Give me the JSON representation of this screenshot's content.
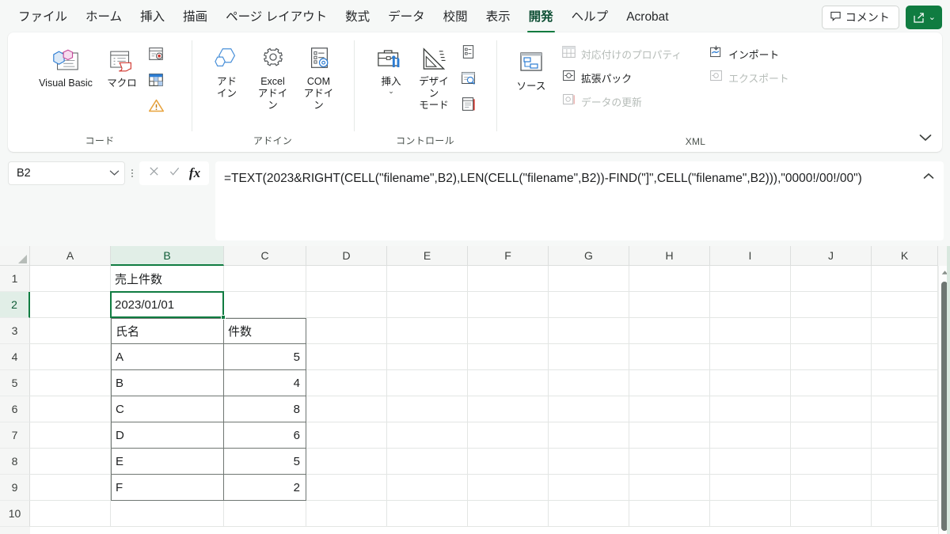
{
  "tabs": [
    {
      "label": "ファイル",
      "active": false
    },
    {
      "label": "ホーム",
      "active": false
    },
    {
      "label": "挿入",
      "active": false
    },
    {
      "label": "描画",
      "active": false
    },
    {
      "label": "ページ レイアウト",
      "active": false
    },
    {
      "label": "数式",
      "active": false
    },
    {
      "label": "データ",
      "active": false
    },
    {
      "label": "校閲",
      "active": false
    },
    {
      "label": "表示",
      "active": false
    },
    {
      "label": "開発",
      "active": true
    },
    {
      "label": "ヘルプ",
      "active": false
    },
    {
      "label": "Acrobat",
      "active": false
    }
  ],
  "titlebar": {
    "comment_label": "コメント",
    "comment_icon": "comment-icon",
    "share_icon": "share-icon",
    "share_caret": "⌄",
    "accent_color": "#107c41"
  },
  "ribbon": {
    "collapse_icon": "chevron-down-icon",
    "groups": [
      {
        "name": "code",
        "title": "コード",
        "big": [
          {
            "label": "Visual Basic",
            "icon": "visual-basic-icon",
            "width": "wide"
          },
          {
            "label": "マクロ",
            "icon": "macro-icon",
            "width": "narrow"
          }
        ],
        "small": [
          {
            "label": "マクロの記録",
            "icon": "record-macro-icon"
          },
          {
            "label": "相対参照で記録",
            "icon": "relative-reference-icon"
          },
          {
            "label": "マクロのセキュリティ",
            "icon": "macro-security-icon"
          }
        ]
      },
      {
        "name": "addins",
        "title": "アドイン",
        "big": [
          {
            "label": "アド\nイン",
            "icon": "addins-icon",
            "width": "narrow"
          },
          {
            "label": "Excel\nアドイン",
            "icon": "excel-addins-icon",
            "width": "narrow"
          },
          {
            "label": "COM\nアドイン",
            "icon": "com-addins-icon",
            "width": "narrow"
          }
        ],
        "small": []
      },
      {
        "name": "controls",
        "title": "コントロール",
        "big": [
          {
            "label": "挿入",
            "icon": "insert-control-icon",
            "width": "narrow",
            "caret": "⌄"
          },
          {
            "label": "デザイン\nモード",
            "icon": "design-mode-icon",
            "width": "narrow"
          }
        ],
        "small": [
          {
            "label": "プロパティ",
            "icon": "properties-icon"
          },
          {
            "label": "コードの表示",
            "icon": "view-code-icon"
          },
          {
            "label": "ダイアログの実行",
            "icon": "run-dialog-icon"
          }
        ]
      },
      {
        "name": "xml",
        "title": "XML",
        "big": [
          {
            "label": "ソース",
            "icon": "xml-source-icon",
            "width": "narrow"
          }
        ],
        "rows_left": [
          {
            "label": "対応付けのプロパティ",
            "icon": "map-properties-icon",
            "disabled": true
          },
          {
            "label": "拡張パック",
            "icon": "expansion-packs-icon",
            "disabled": false
          },
          {
            "label": "データの更新",
            "icon": "refresh-data-icon",
            "disabled": true
          }
        ],
        "rows_right": [
          {
            "label": "インポート",
            "icon": "import-icon",
            "disabled": false
          },
          {
            "label": "エクスポート",
            "icon": "export-icon",
            "disabled": true
          }
        ]
      }
    ]
  },
  "formula_bar": {
    "namebox_value": "B2",
    "namebox_caret": "⌄",
    "more_icon": "more-vertical-icon",
    "cancel_icon": "cancel-icon",
    "enter_icon": "enter-icon",
    "fx_icon": "insert-function-icon",
    "fx_label": "fx",
    "formula": "=TEXT(2023&RIGHT(CELL(\"filename\",B2),LEN(CELL(\"filename\",B2))-FIND(\"]\",CELL(\"filename\",B2))),\"0000!/00!/00\")",
    "expand_icon": "chevron-up-icon"
  },
  "grid": {
    "columns": [
      {
        "label": "A",
        "width": 102,
        "selected": false
      },
      {
        "label": "B",
        "width": 143,
        "selected": true
      },
      {
        "label": "C",
        "width": 104,
        "selected": false
      },
      {
        "label": "D",
        "width": 102,
        "selected": false
      },
      {
        "label": "E",
        "width": 102,
        "selected": false
      },
      {
        "label": "F",
        "width": 102,
        "selected": false
      },
      {
        "label": "G",
        "width": 102,
        "selected": false
      },
      {
        "label": "H",
        "width": 102,
        "selected": false
      },
      {
        "label": "I",
        "width": 102,
        "selected": false
      },
      {
        "label": "J",
        "width": 102,
        "selected": false
      },
      {
        "label": "K",
        "width": 84,
        "selected": false
      }
    ],
    "rows": [
      {
        "header": "1",
        "selected": false,
        "cells": {
          "B": "売上件数"
        }
      },
      {
        "header": "2",
        "selected": true,
        "cells": {
          "B": "2023/01/01"
        }
      },
      {
        "header": "3",
        "selected": false,
        "cells": {
          "B": "氏名",
          "C": "件数"
        }
      },
      {
        "header": "4",
        "selected": false,
        "cells": {
          "B": "A",
          "C": "5"
        }
      },
      {
        "header": "5",
        "selected": false,
        "cells": {
          "B": "B",
          "C": "4"
        }
      },
      {
        "header": "6",
        "selected": false,
        "cells": {
          "B": "C",
          "C": "8"
        }
      },
      {
        "header": "7",
        "selected": false,
        "cells": {
          "B": "D",
          "C": "6"
        }
      },
      {
        "header": "8",
        "selected": false,
        "cells": {
          "B": "E",
          "C": "5"
        }
      },
      {
        "header": "9",
        "selected": false,
        "cells": {
          "B": "F",
          "C": "2"
        }
      },
      {
        "header": "10",
        "selected": false,
        "cells": {}
      }
    ],
    "active_cell": "B2",
    "selection_color": "#107c41",
    "scroll_up_icon": "scroll-up-arrow-icon"
  }
}
